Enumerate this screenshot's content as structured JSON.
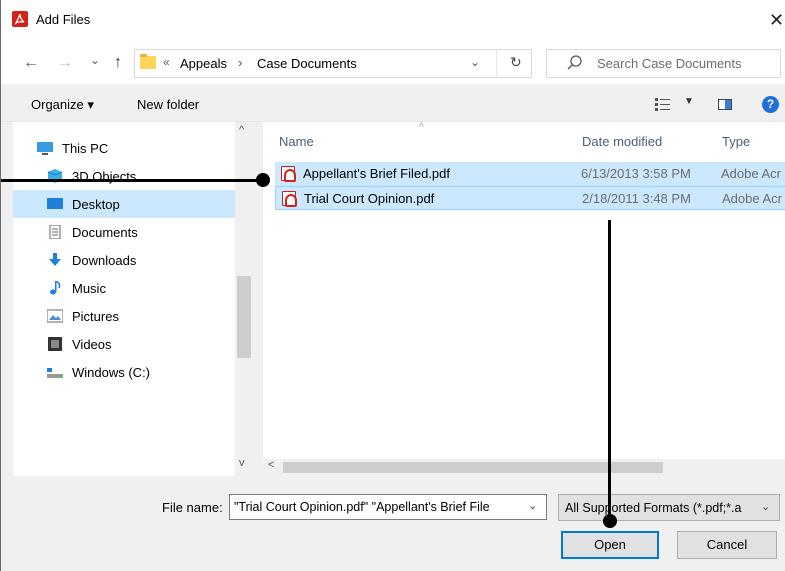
{
  "window": {
    "title": "Add Files",
    "close_glyph": "✕"
  },
  "nav": {
    "back_glyph": "←",
    "forward_glyph": "→",
    "recent_glyph": "⌄",
    "up_glyph": "↑",
    "address": {
      "overflow_glyph": "«",
      "crumbs": [
        "Appeals",
        "Case Documents"
      ],
      "separator": "›",
      "dropdown_glyph": "⌄",
      "refresh_glyph": "↻"
    },
    "search": {
      "placeholder": "Search Case Documents"
    }
  },
  "toolbar": {
    "organize_label": "Organize ▾",
    "new_folder_label": "New folder",
    "view_caret": "▼",
    "help_label": "?"
  },
  "sidebar": {
    "items": [
      {
        "label": "This PC",
        "icon": "pc-icon"
      },
      {
        "label": "3D Objects",
        "icon": "cube-icon"
      },
      {
        "label": "Desktop",
        "icon": "desktop-icon",
        "selected": true
      },
      {
        "label": "Documents",
        "icon": "document-icon"
      },
      {
        "label": "Downloads",
        "icon": "download-icon"
      },
      {
        "label": "Music",
        "icon": "music-icon"
      },
      {
        "label": "Pictures",
        "icon": "pictures-icon"
      },
      {
        "label": "Videos",
        "icon": "video-icon"
      },
      {
        "label": "Windows (C:)",
        "icon": "drive-icon"
      }
    ],
    "scroll_up": "^",
    "scroll_down": "v"
  },
  "files": {
    "columns": [
      "Name",
      "Date modified",
      "Type"
    ],
    "sort_caret": "^",
    "rows": [
      {
        "name": "Appellant's Brief Filed.pdf",
        "date": "6/13/2013 3:58 PM",
        "type": "Adobe Acr"
      },
      {
        "name": "Trial Court Opinion.pdf",
        "date": "2/18/2011 3:48 PM",
        "type": "Adobe Acr"
      }
    ],
    "scroll_left": "<"
  },
  "footer": {
    "file_name_label": "File name:",
    "file_name_value": "\"Trial Court Opinion.pdf\" \"Appellant's Brief File",
    "file_name_dropdown": "⌄",
    "filter_value": "All Supported Formats (*.pdf;*.a",
    "filter_dropdown": "⌄",
    "open_label": "Open",
    "cancel_label": "Cancel"
  },
  "colors": {
    "selection": "#cce8ff",
    "accent": "#0078d7",
    "pdf_red": "#d32219"
  }
}
